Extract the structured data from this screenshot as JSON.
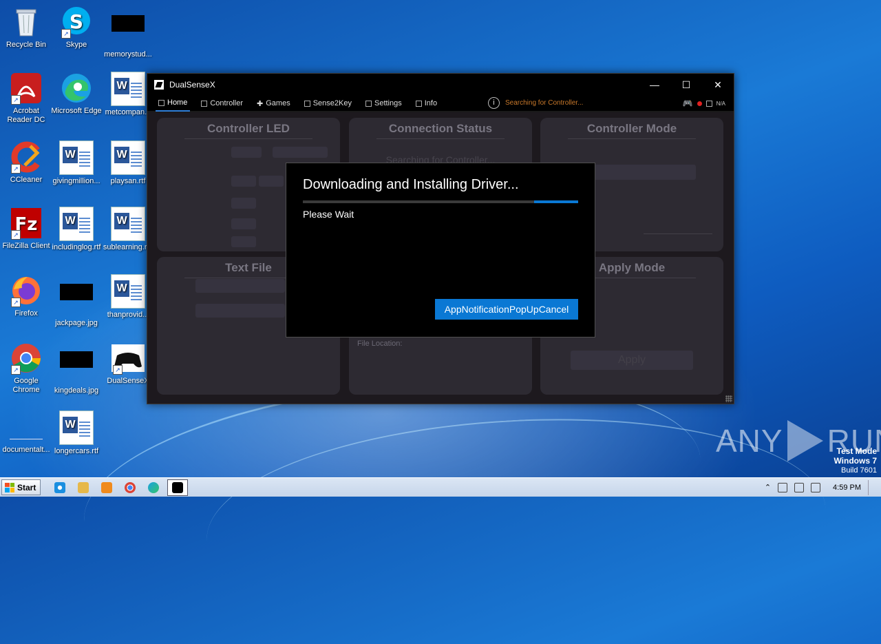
{
  "desktop": {
    "icons": [
      {
        "label": "Recycle Bin",
        "icon": "recycle-bin-icon"
      },
      {
        "label": "Skype",
        "icon": "skype-icon"
      },
      {
        "label": "memorystud...",
        "icon": "image-thumbnail"
      },
      {
        "label": "Acrobat Reader DC",
        "icon": "acrobat-icon"
      },
      {
        "label": "Microsoft Edge",
        "icon": "edge-icon"
      },
      {
        "label": "metcompan...",
        "icon": "word-doc-icon"
      },
      {
        "label": "CCleaner",
        "icon": "ccleaner-icon"
      },
      {
        "label": "givingmillion...",
        "icon": "word-doc-icon"
      },
      {
        "label": "playsan.rtf",
        "icon": "word-doc-icon"
      },
      {
        "label": "FileZilla Client",
        "icon": "filezilla-icon"
      },
      {
        "label": "includinglog.rtf",
        "icon": "word-doc-icon"
      },
      {
        "label": "sublearning.r...",
        "icon": "word-doc-icon"
      },
      {
        "label": "Firefox",
        "icon": "firefox-icon"
      },
      {
        "label": "jackpage.jpg",
        "icon": "image-thumbnail"
      },
      {
        "label": "thanprovid...",
        "icon": "word-doc-icon"
      },
      {
        "label": "Google Chrome",
        "icon": "chrome-icon"
      },
      {
        "label": "kingdeals.jpg",
        "icon": "image-thumbnail"
      },
      {
        "label": "DualSenseX",
        "icon": "controller-icon"
      },
      {
        "label": "documentalt...",
        "icon": "blank-file-icon"
      },
      {
        "label": "longercars.rtf",
        "icon": "word-doc-icon"
      }
    ]
  },
  "window": {
    "title": "DualSenseX",
    "controls": {
      "minimize": "—",
      "maximize": "☐",
      "close": "✕"
    },
    "tabs": [
      {
        "label": "Home",
        "active": true
      },
      {
        "label": "Controller",
        "active": false
      },
      {
        "label": "Games",
        "active": false
      },
      {
        "label": "Sense2Key",
        "active": false
      },
      {
        "label": "Settings",
        "active": false
      },
      {
        "label": "Info",
        "active": false
      }
    ],
    "status_text": "Searching for Controller...",
    "status_color": "#c8782a",
    "battery_text": "N/A",
    "panels": {
      "controller_led": "Controller LED",
      "connection_status": "Connection Status",
      "connection_searching": "Searching for Controller...",
      "controller_mode": "Controller Mode",
      "text_file": "Text File",
      "apply_mode": "Apply Mode",
      "file_location": "File Location:",
      "apply": "Apply"
    }
  },
  "dialog": {
    "title": "Downloading and Installing Driver...",
    "progress": 0.16,
    "message": "Please Wait",
    "cancel_label": "AppNotificationPopUpCancel",
    "accent": "#0a78d4"
  },
  "watermark": {
    "brand_left": "ANY",
    "brand_right": "RUN",
    "line1": "Test Mode",
    "line2": "Windows 7",
    "line3": "Build 7601"
  },
  "taskbar": {
    "start_label": "Start",
    "clock": "4:59 PM",
    "apps": [
      "ie-icon",
      "explorer-icon",
      "media-player-icon",
      "chrome-icon",
      "edge-icon",
      "dualsensex-icon"
    ]
  }
}
